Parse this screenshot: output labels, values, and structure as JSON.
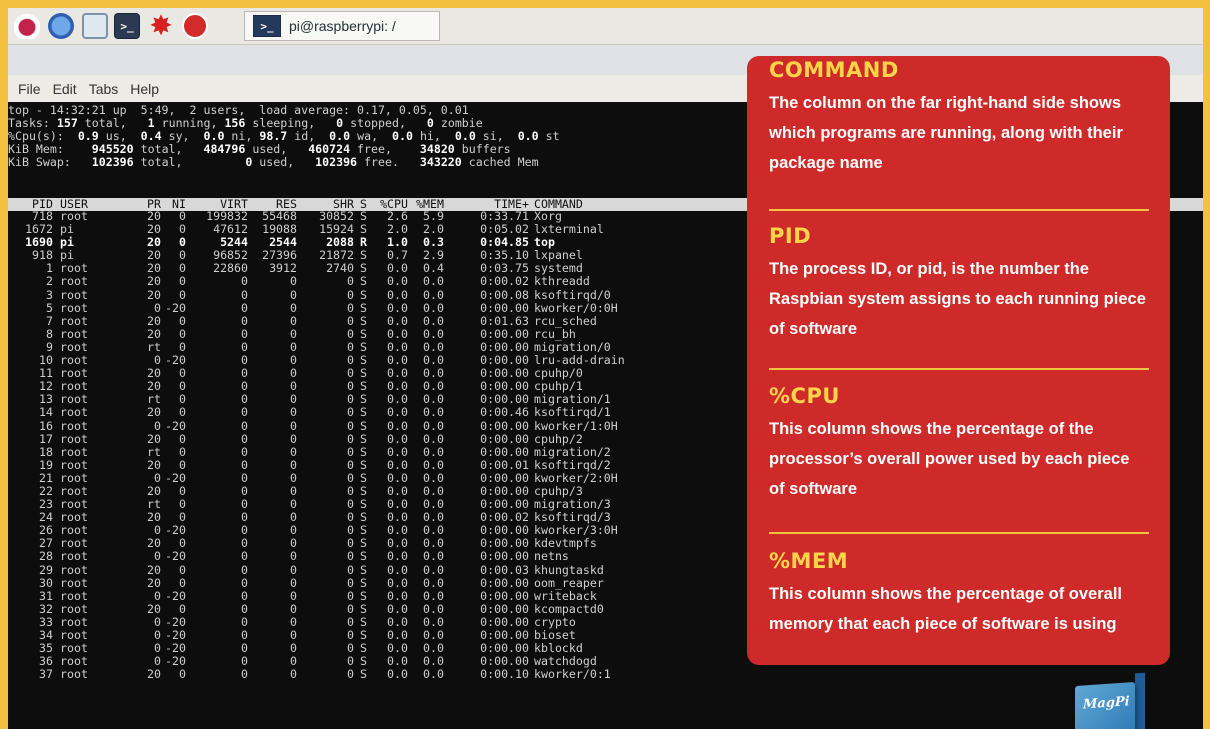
{
  "taskbar": {
    "icons": [
      "raspberry-menu-icon",
      "web-browser-icon",
      "file-manager-icon",
      "terminal-icon",
      "mathematica-icon",
      "wolfram-icon"
    ],
    "task_label": "pi@raspberrypi: /"
  },
  "menu": [
    "File",
    "Edit",
    "Tabs",
    "Help"
  ],
  "summary": {
    "line1": "top - 14:32:21 up  5:49,  2 users,  load average: 0.17, 0.05, 0.01",
    "line2_a": "Tasks: ",
    "line2_total": "157",
    "line2_b": " total,   ",
    "line2_run": "1",
    "line2_c": " running, ",
    "line2_sleep": "156",
    "line2_d": " sleeping,   ",
    "line2_stop": "0",
    "line2_e": " stopped,   ",
    "line2_zomb": "0",
    "line2_f": " zombie",
    "line3_a": "%Cpu(s):  ",
    "line3_us": "0.9",
    "line3_b": " us,  ",
    "line3_sy": "0.4",
    "line3_c": " sy,  ",
    "line3_ni": "0.0",
    "line3_d": " ni, ",
    "line3_id": "98.7",
    "line3_e": " id,  ",
    "line3_wa": "0.0",
    "line3_f": " wa,  ",
    "line3_hi": "0.0",
    "line3_g": " hi,  ",
    "line3_si": "0.0",
    "line3_h": " si,  ",
    "line3_st": "0.0",
    "line3_i": " st",
    "line4_a": "KiB Mem:    ",
    "line4_total": "945520",
    "line4_b": " total,   ",
    "line4_used": "484796",
    "line4_c": " used,   ",
    "line4_free": "460724",
    "line4_d": " free,    ",
    "line4_buf": "34820",
    "line4_e": " buffers",
    "line5_a": "KiB Swap:   ",
    "line5_total": "102396",
    "line5_b": " total,         ",
    "line5_used": "0",
    "line5_c": " used,   ",
    "line5_free": "102396",
    "line5_d": " free.   ",
    "line5_cache": "343220",
    "line5_e": " cached Mem"
  },
  "table": {
    "headers": [
      "PID",
      "USER",
      "PR",
      "NI",
      "VIRT",
      "RES",
      "SHR",
      "S",
      "%CPU",
      "%MEM",
      "TIME+",
      "COMMAND"
    ],
    "rows": [
      [
        "718",
        "root",
        "20",
        "0",
        "199832",
        "55468",
        "30852",
        "S",
        "2.6",
        "5.9",
        "0:33.71",
        "Xorg"
      ],
      [
        "1672",
        "pi",
        "20",
        "0",
        "47612",
        "19088",
        "15924",
        "S",
        "2.0",
        "2.0",
        "0:05.02",
        "lxterminal"
      ],
      [
        "1690",
        "pi",
        "20",
        "0",
        "5244",
        "2544",
        "2088",
        "R",
        "1.0",
        "0.3",
        "0:04.85",
        "top"
      ],
      [
        "918",
        "pi",
        "20",
        "0",
        "96852",
        "27396",
        "21872",
        "S",
        "0.7",
        "2.9",
        "0:35.10",
        "lxpanel"
      ],
      [
        "1",
        "root",
        "20",
        "0",
        "22860",
        "3912",
        "2740",
        "S",
        "0.0",
        "0.4",
        "0:03.75",
        "systemd"
      ],
      [
        "2",
        "root",
        "20",
        "0",
        "0",
        "0",
        "0",
        "S",
        "0.0",
        "0.0",
        "0:00.02",
        "kthreadd"
      ],
      [
        "3",
        "root",
        "20",
        "0",
        "0",
        "0",
        "0",
        "S",
        "0.0",
        "0.0",
        "0:00.08",
        "ksoftirqd/0"
      ],
      [
        "5",
        "root",
        "0",
        "-20",
        "0",
        "0",
        "0",
        "S",
        "0.0",
        "0.0",
        "0:00.00",
        "kworker/0:0H"
      ],
      [
        "7",
        "root",
        "20",
        "0",
        "0",
        "0",
        "0",
        "S",
        "0.0",
        "0.0",
        "0:01.63",
        "rcu_sched"
      ],
      [
        "8",
        "root",
        "20",
        "0",
        "0",
        "0",
        "0",
        "S",
        "0.0",
        "0.0",
        "0:00.00",
        "rcu_bh"
      ],
      [
        "9",
        "root",
        "rt",
        "0",
        "0",
        "0",
        "0",
        "S",
        "0.0",
        "0.0",
        "0:00.00",
        "migration/0"
      ],
      [
        "10",
        "root",
        "0",
        "-20",
        "0",
        "0",
        "0",
        "S",
        "0.0",
        "0.0",
        "0:00.00",
        "lru-add-drain"
      ],
      [
        "11",
        "root",
        "20",
        "0",
        "0",
        "0",
        "0",
        "S",
        "0.0",
        "0.0",
        "0:00.00",
        "cpuhp/0"
      ],
      [
        "12",
        "root",
        "20",
        "0",
        "0",
        "0",
        "0",
        "S",
        "0.0",
        "0.0",
        "0:00.00",
        "cpuhp/1"
      ],
      [
        "13",
        "root",
        "rt",
        "0",
        "0",
        "0",
        "0",
        "S",
        "0.0",
        "0.0",
        "0:00.00",
        "migration/1"
      ],
      [
        "14",
        "root",
        "20",
        "0",
        "0",
        "0",
        "0",
        "S",
        "0.0",
        "0.0",
        "0:00.46",
        "ksoftirqd/1"
      ],
      [
        "16",
        "root",
        "0",
        "-20",
        "0",
        "0",
        "0",
        "S",
        "0.0",
        "0.0",
        "0:00.00",
        "kworker/1:0H"
      ],
      [
        "17",
        "root",
        "20",
        "0",
        "0",
        "0",
        "0",
        "S",
        "0.0",
        "0.0",
        "0:00.00",
        "cpuhp/2"
      ],
      [
        "18",
        "root",
        "rt",
        "0",
        "0",
        "0",
        "0",
        "S",
        "0.0",
        "0.0",
        "0:00.00",
        "migration/2"
      ],
      [
        "19",
        "root",
        "20",
        "0",
        "0",
        "0",
        "0",
        "S",
        "0.0",
        "0.0",
        "0:00.01",
        "ksoftirqd/2"
      ],
      [
        "21",
        "root",
        "0",
        "-20",
        "0",
        "0",
        "0",
        "S",
        "0.0",
        "0.0",
        "0:00.00",
        "kworker/2:0H"
      ],
      [
        "22",
        "root",
        "20",
        "0",
        "0",
        "0",
        "0",
        "S",
        "0.0",
        "0.0",
        "0:00.00",
        "cpuhp/3"
      ],
      [
        "23",
        "root",
        "rt",
        "0",
        "0",
        "0",
        "0",
        "S",
        "0.0",
        "0.0",
        "0:00.00",
        "migration/3"
      ],
      [
        "24",
        "root",
        "20",
        "0",
        "0",
        "0",
        "0",
        "S",
        "0.0",
        "0.0",
        "0:00.02",
        "ksoftirqd/3"
      ],
      [
        "26",
        "root",
        "0",
        "-20",
        "0",
        "0",
        "0",
        "S",
        "0.0",
        "0.0",
        "0:00.00",
        "kworker/3:0H"
      ],
      [
        "27",
        "root",
        "20",
        "0",
        "0",
        "0",
        "0",
        "S",
        "0.0",
        "0.0",
        "0:00.00",
        "kdevtmpfs"
      ],
      [
        "28",
        "root",
        "0",
        "-20",
        "0",
        "0",
        "0",
        "S",
        "0.0",
        "0.0",
        "0:00.00",
        "netns"
      ],
      [
        "29",
        "root",
        "20",
        "0",
        "0",
        "0",
        "0",
        "S",
        "0.0",
        "0.0",
        "0:00.03",
        "khungtaskd"
      ],
      [
        "30",
        "root",
        "20",
        "0",
        "0",
        "0",
        "0",
        "S",
        "0.0",
        "0.0",
        "0:00.00",
        "oom_reaper"
      ],
      [
        "31",
        "root",
        "0",
        "-20",
        "0",
        "0",
        "0",
        "S",
        "0.0",
        "0.0",
        "0:00.00",
        "writeback"
      ],
      [
        "32",
        "root",
        "20",
        "0",
        "0",
        "0",
        "0",
        "S",
        "0.0",
        "0.0",
        "0:00.00",
        "kcompactd0"
      ],
      [
        "33",
        "root",
        "0",
        "-20",
        "0",
        "0",
        "0",
        "S",
        "0.0",
        "0.0",
        "0:00.00",
        "crypto"
      ],
      [
        "34",
        "root",
        "0",
        "-20",
        "0",
        "0",
        "0",
        "S",
        "0.0",
        "0.0",
        "0:00.00",
        "bioset"
      ],
      [
        "35",
        "root",
        "0",
        "-20",
        "0",
        "0",
        "0",
        "S",
        "0.0",
        "0.0",
        "0:00.00",
        "kblockd"
      ],
      [
        "36",
        "root",
        "0",
        "-20",
        "0",
        "0",
        "0",
        "S",
        "0.0",
        "0.0",
        "0:00.00",
        "watchdogd"
      ],
      [
        "37",
        "root",
        "20",
        "0",
        "0",
        "0",
        "0",
        "S",
        "0.0",
        "0.0",
        "0:00.10",
        "kworker/0:1"
      ]
    ]
  },
  "callout": {
    "sections": [
      {
        "title": "COMMAND",
        "body": "The column on the far right-hand side shows which programs are running, along with their package name"
      },
      {
        "title": "PID",
        "body": "The process ID, or pid, is the number the Raspbian system assigns to each running piece of software"
      },
      {
        "title": "%CPU",
        "body": "This column shows the percentage of the processor’s overall power used by each piece of software"
      },
      {
        "title": "%MEM",
        "body": "This column shows the percentage of overall memory that each piece of software is using"
      }
    ]
  },
  "magazine_label": "MagPi",
  "colors": {
    "frame": "#f4c040",
    "callout": "#cf2a2a",
    "callout_title": "#ffd44a",
    "terminal_bg": "#0d0d0d"
  }
}
